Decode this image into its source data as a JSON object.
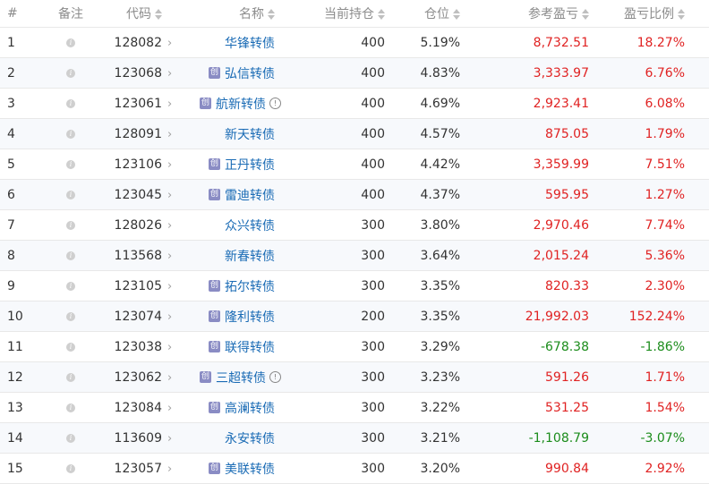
{
  "header": {
    "index": "#",
    "note": "备注",
    "code": "代码",
    "name": "名称",
    "holding": "当前持仓",
    "position": "仓位",
    "pnl": "参考盈亏",
    "pnl_ratio": "盈亏比例"
  },
  "badge_char": "创",
  "colors": {
    "positive": "#e02222",
    "negative": "#1b8c1b",
    "link": "#1a6bb5",
    "badge": "#8a8cc4"
  },
  "rows": [
    {
      "idx": "1",
      "code": "128082",
      "name": "华锋转债",
      "badge": false,
      "info": false,
      "holding": "400",
      "position": "5.19%",
      "pnl": "8,732.51",
      "ratio": "18.27%",
      "negative": false
    },
    {
      "idx": "2",
      "code": "123068",
      "name": "弘信转债",
      "badge": true,
      "info": false,
      "holding": "400",
      "position": "4.83%",
      "pnl": "3,333.97",
      "ratio": "6.76%",
      "negative": false
    },
    {
      "idx": "3",
      "code": "123061",
      "name": "航新转债",
      "badge": true,
      "info": true,
      "holding": "400",
      "position": "4.69%",
      "pnl": "2,923.41",
      "ratio": "6.08%",
      "negative": false
    },
    {
      "idx": "4",
      "code": "128091",
      "name": "新天转债",
      "badge": false,
      "info": false,
      "holding": "400",
      "position": "4.57%",
      "pnl": "875.05",
      "ratio": "1.79%",
      "negative": false
    },
    {
      "idx": "5",
      "code": "123106",
      "name": "正丹转债",
      "badge": true,
      "info": false,
      "holding": "400",
      "position": "4.42%",
      "pnl": "3,359.99",
      "ratio": "7.51%",
      "negative": false
    },
    {
      "idx": "6",
      "code": "123045",
      "name": "雷迪转债",
      "badge": true,
      "info": false,
      "holding": "400",
      "position": "4.37%",
      "pnl": "595.95",
      "ratio": "1.27%",
      "negative": false
    },
    {
      "idx": "7",
      "code": "128026",
      "name": "众兴转债",
      "badge": false,
      "info": false,
      "holding": "300",
      "position": "3.80%",
      "pnl": "2,970.46",
      "ratio": "7.74%",
      "negative": false
    },
    {
      "idx": "8",
      "code": "113568",
      "name": "新春转债",
      "badge": false,
      "info": false,
      "holding": "300",
      "position": "3.64%",
      "pnl": "2,015.24",
      "ratio": "5.36%",
      "negative": false
    },
    {
      "idx": "9",
      "code": "123105",
      "name": "拓尔转债",
      "badge": true,
      "info": false,
      "holding": "300",
      "position": "3.35%",
      "pnl": "820.33",
      "ratio": "2.30%",
      "negative": false
    },
    {
      "idx": "10",
      "code": "123074",
      "name": "隆利转债",
      "badge": true,
      "info": false,
      "holding": "200",
      "position": "3.35%",
      "pnl": "21,992.03",
      "ratio": "152.24%",
      "negative": false
    },
    {
      "idx": "11",
      "code": "123038",
      "name": "联得转债",
      "badge": true,
      "info": false,
      "holding": "300",
      "position": "3.29%",
      "pnl": "-678.38",
      "ratio": "-1.86%",
      "negative": true
    },
    {
      "idx": "12",
      "code": "123062",
      "name": "三超转债",
      "badge": true,
      "info": true,
      "holding": "300",
      "position": "3.23%",
      "pnl": "591.26",
      "ratio": "1.71%",
      "negative": false
    },
    {
      "idx": "13",
      "code": "123084",
      "name": "高澜转债",
      "badge": true,
      "info": false,
      "holding": "300",
      "position": "3.22%",
      "pnl": "531.25",
      "ratio": "1.54%",
      "negative": false
    },
    {
      "idx": "14",
      "code": "113609",
      "name": "永安转债",
      "badge": false,
      "info": false,
      "holding": "300",
      "position": "3.21%",
      "pnl": "-1,108.79",
      "ratio": "-3.07%",
      "negative": true
    },
    {
      "idx": "15",
      "code": "123057",
      "name": "美联转债",
      "badge": true,
      "info": false,
      "holding": "300",
      "position": "3.20%",
      "pnl": "990.84",
      "ratio": "2.92%",
      "negative": false
    }
  ]
}
